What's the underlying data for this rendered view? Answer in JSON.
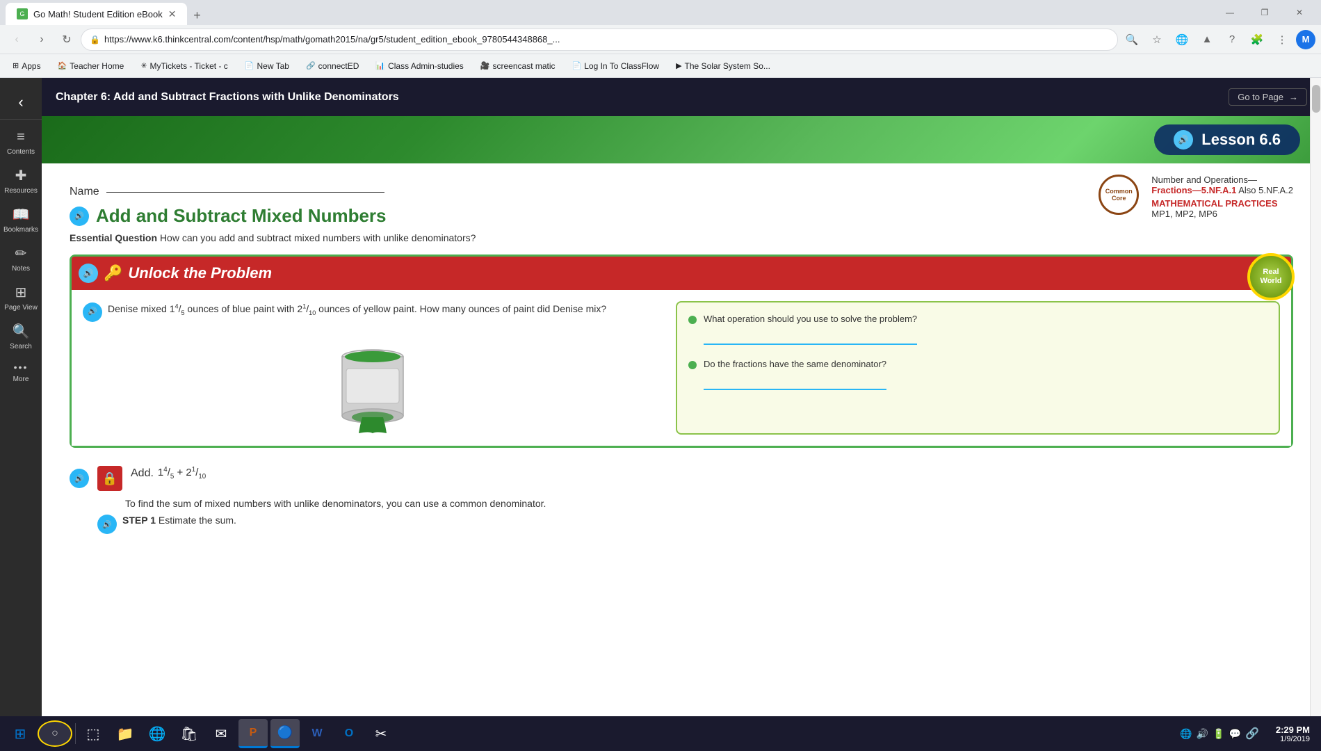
{
  "browser": {
    "tab_title": "Go Math! Student Edition eBook",
    "tab_favicon": "G",
    "url": "https://www.k6.thinkcentral.com/content/hsp/math/gomath2015/na/gr5/student_edition_ebook_9780544348868_...",
    "bookmarks": [
      "Apps",
      "Teacher Home",
      "MyTickets - Ticket - c",
      "New Tab",
      "connectED",
      "Class Admin-studies",
      "screencast matic",
      "Log In To ClassFlow",
      "The Solar System So..."
    ],
    "profile_initial": "M"
  },
  "ebook": {
    "chapter_title": "Chapter 6: Add and Subtract Fractions with Unlike Denominators",
    "go_to_page_label": "Go to Page",
    "lesson_label": "Lesson 6.6",
    "name_label": "Name",
    "main_title": "Add and Subtract Mixed Numbers",
    "essential_question_label": "Essential Question",
    "essential_question_text": "How can you add and subtract mixed numbers with unlike denominators?",
    "common_core_line1": "Common",
    "common_core_line2": "Core",
    "standards_label": "Number and Operations—",
    "standards_fraction": "Fractions—5.NF.A.1",
    "standards_also": "Also 5.NF.A.2",
    "math_practices_label": "MATHEMATICAL PRACTICES",
    "math_practices_list": "MP1, MP2, MP6",
    "unlock_title": "Unlock the Problem",
    "real_world_line1": "Real",
    "real_world_line2": "World",
    "problem_text": "Denise mixed 1⁴⁄₅ ounces of blue paint with 2¹⁄₁₀ ounces of yellow paint. How many ounces of paint did Denise mix?",
    "question1": "What operation should you use to solve the problem?",
    "question2": "Do the fractions have the same denominator?",
    "add_label": "Add.",
    "add_expression": "1⁴⁄₅ + 2¹⁄₁₀",
    "to_find_text": "To find the sum of mixed numbers with unlike denominators, you can use a common denominator.",
    "step1_label": "STEP 1",
    "step1_text": "Estimate the sum."
  },
  "sidebar": {
    "back_icon": "‹",
    "items": [
      {
        "id": "contents",
        "icon": "≡",
        "label": "Contents"
      },
      {
        "id": "resources",
        "icon": "＋",
        "label": "Resources"
      },
      {
        "id": "bookmarks",
        "icon": "📖",
        "label": "Bookmarks"
      },
      {
        "id": "notes",
        "icon": "✏",
        "label": "Notes"
      },
      {
        "id": "page-view",
        "icon": "⊞",
        "label": "Page View"
      },
      {
        "id": "search",
        "icon": "🔍",
        "label": "Search"
      },
      {
        "id": "more",
        "icon": "•••",
        "label": "More"
      }
    ]
  },
  "taskbar": {
    "time": "2:29 PM",
    "date": "1/9/2019",
    "apps": [
      "⊞",
      "⬚",
      "📁",
      "🌐",
      "🛍",
      "✉",
      "P",
      "🔵",
      "W",
      "O",
      "⬚"
    ]
  }
}
